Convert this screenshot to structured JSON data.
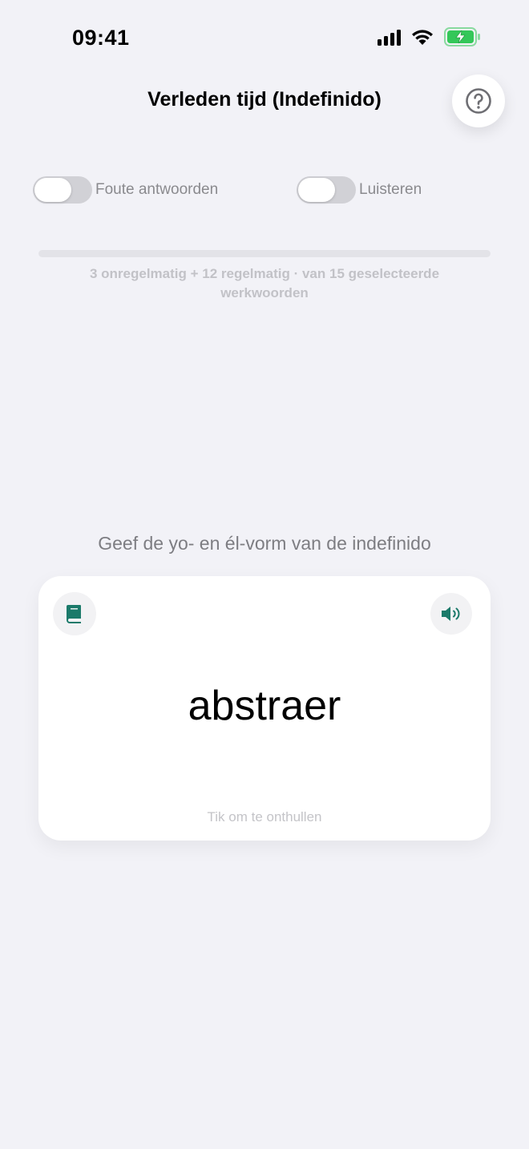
{
  "status_bar": {
    "time": "09:41"
  },
  "header": {
    "title": "Verleden tijd (Indefinido)",
    "help_icon": "question-circle-icon"
  },
  "toggles": [
    {
      "label": "Foute antwoorden",
      "on": false
    },
    {
      "label": "Luisteren",
      "on": false
    }
  ],
  "progress": {
    "fraction": 0,
    "text": "3 onregelmatig + 12 regelmatig · van 15 geselecteerde werkwoorden"
  },
  "prompt": "Geef de yo- en él-vorm van de indefinido",
  "card": {
    "word": "abstraer",
    "hint": "Tik om te onthullen",
    "left_icon": "book-icon",
    "right_icon": "speaker-icon"
  },
  "colors": {
    "accent": "#1b7a6a",
    "background": "#f2f2f7",
    "battery": "#34c759"
  }
}
